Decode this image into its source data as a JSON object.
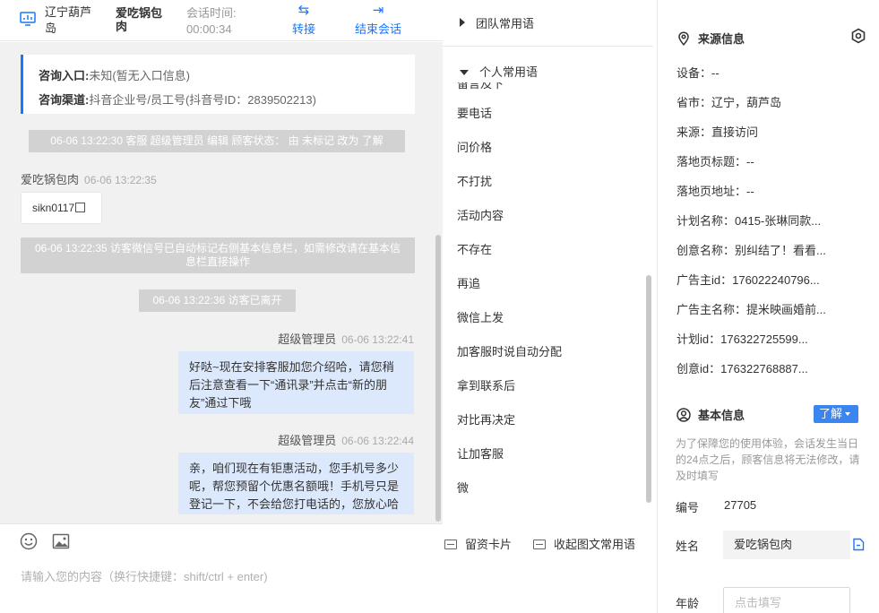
{
  "header": {
    "location": "辽宁葫芦岛",
    "customer_name": "爱吃锅包肉",
    "session_label": "会话时间:",
    "session_time": "00:00:34",
    "transfer_label": "转接",
    "end_label": "结束会话"
  },
  "source_card": {
    "entry_label": "咨询入口:",
    "entry_value": "未知(暂无入口信息)",
    "channel_label": "咨询渠道:",
    "channel_value": "抖音企业号/员工号(抖音号ID：2839502213)"
  },
  "messages": {
    "sys1": "06-06 13:22:30 客服 超级管理员 编辑 顾客状态： 由 未标记 改为 了解",
    "customer_name": "爱吃锅包肉",
    "customer_time": "06-06 13:22:35",
    "customer_text": "sikn0117",
    "sys2": "06-06 13:22:35 访客微信号已自动标记右侧基本信息栏，如需修改请在基本信息栏直接操作",
    "sys3": "06-06 13:22:36 访客已离开",
    "agent1_name": "超级管理员",
    "agent1_time": "06-06 13:22:41",
    "agent1_text": "好哒~现在安排客服加您介绍哈，请您稍后注意查看一下“通讯录”并点击“新的朋友”通过下哦",
    "agent2_name": "超级管理员",
    "agent2_time": "06-06 13:22:44",
    "agent2_text": "亲，咱们现在有钜惠活动，您手机号多少呢，帮您预留个优惠名额哦！手机号只是登记一下，不会给您打电话的，您放心哈"
  },
  "composer": {
    "placeholder": "请输入您的内容（换行快捷键：shift/ctrl + enter)",
    "emoji_icon": "emoji-icon",
    "image_icon": "image-icon"
  },
  "phrases": {
    "team_group": "团队常用语",
    "personal_group": "个人常用语",
    "clipped_item": "留言及下",
    "items": [
      "要电话",
      "问价格",
      "不打扰",
      "活动内容",
      "不存在",
      "再追",
      "微信上发",
      "加客服时说自动分配",
      "拿到联系后",
      "对比再决定",
      "让加客服",
      "微"
    ],
    "tool_card": "留资卡片",
    "tool_promo": "收起图文常用语"
  },
  "source_info": {
    "title": "来源信息",
    "rows": [
      "设备：--",
      "省市：辽宁，葫芦岛",
      "来源：直接访问",
      "落地页标题：--",
      "落地页地址：--",
      "计划名称：0415-张琳同款...",
      "创意名称：别纠结了！看看...",
      "广告主id：176022240796...",
      "广告主名称：提米映画婚前...",
      "计划id：176322725599...",
      "创意id：176322768887..."
    ]
  },
  "basic_info": {
    "title": "基本信息",
    "level": "了解",
    "notice": "为了保障您的使用体验，会话发生当日的24点之后，顾客信息将无法修改，请及时填写",
    "id_label": "编号",
    "id_value": "27705",
    "name_label": "姓名",
    "name_value": "爱吃锅包肉",
    "age_label": "年龄",
    "age_placeholder": "点击填写"
  },
  "colors": {
    "accent": "#1677ff",
    "agent_bubble": "#dce8fb",
    "system_msg": "#d2d2d2",
    "chat_bg": "#f1f1f1"
  }
}
